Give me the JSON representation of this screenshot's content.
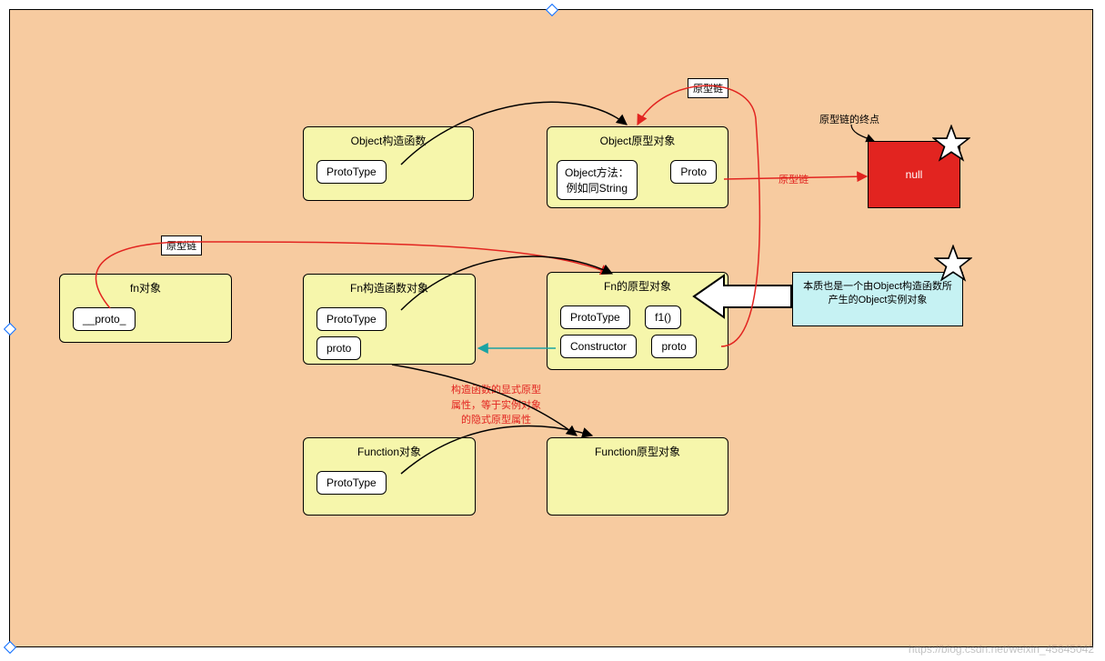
{
  "watermark": "https://blog.csdn.net/weixin_45845042",
  "boxes": {
    "objCtor": {
      "title": "Object构造函数",
      "prototype": "ProtoType"
    },
    "objProto": {
      "title": "Object原型对象",
      "methods": "Object方法：\n例如同String",
      "proto": "Proto"
    },
    "fnObj": {
      "title": "fn对象",
      "proto": "__proto_"
    },
    "fnCtor": {
      "title": "Fn构造函数对象",
      "prototype": "ProtoType",
      "proto": "proto"
    },
    "fnProto": {
      "title": "Fn的原型对象",
      "prototype": "ProtoType",
      "f1": "f1()",
      "constructor": "Constructor",
      "proto": "proto"
    },
    "funcObj": {
      "title": "Function对象",
      "prototype": "ProtoType"
    },
    "funcProto": {
      "title": "Function原型对象"
    },
    "nullBox": "null",
    "cyan": "本质也是一个由Object构造函数所产生的Object实例对象"
  },
  "labels": {
    "chain1": "原型链",
    "chain2": "原型链",
    "chain3": "原型链",
    "endpoint": "原型链的终点",
    "redCenter": "构造函数的显式原型\n属性，等于实例对象\n的隐式原型属性"
  }
}
